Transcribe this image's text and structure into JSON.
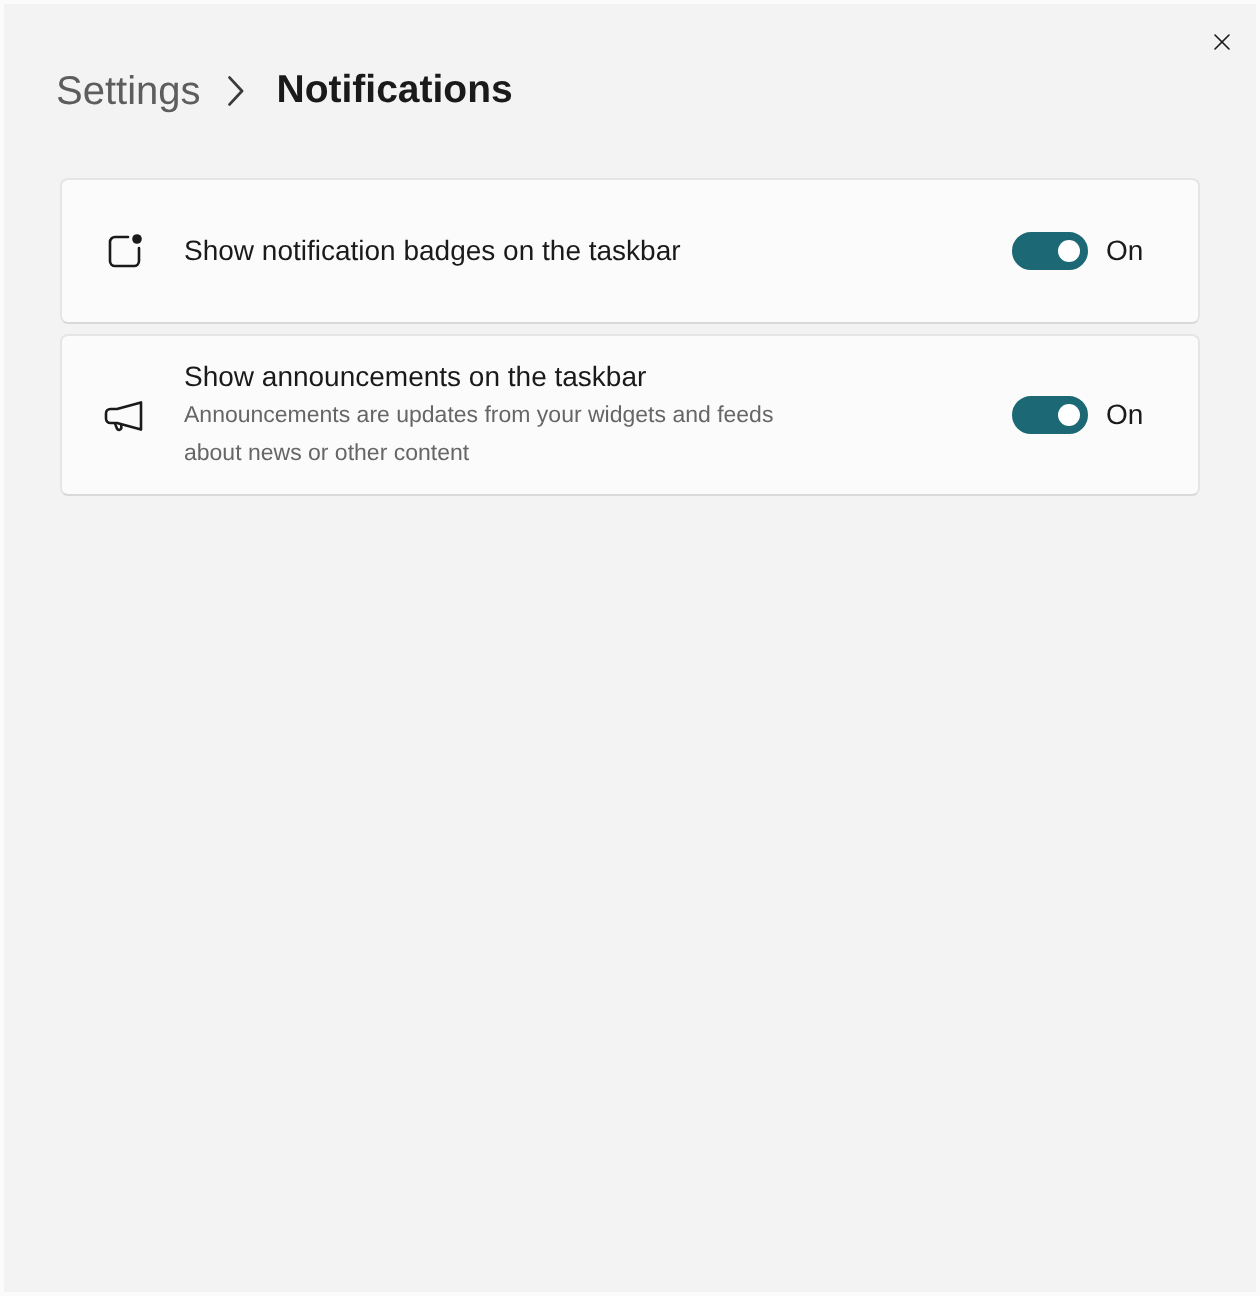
{
  "breadcrumb": [
    {
      "label": "Settings",
      "current": false
    },
    {
      "label": "Notifications",
      "current": true
    }
  ],
  "settings": [
    {
      "title": "Show notification badges on the taskbar",
      "on": true,
      "state_label": "On"
    },
    {
      "title": "Show announcements on the taskbar",
      "description": "Announcements are updates from your widgets and feeds about news or other content",
      "on": true,
      "state_label": "On"
    }
  ]
}
